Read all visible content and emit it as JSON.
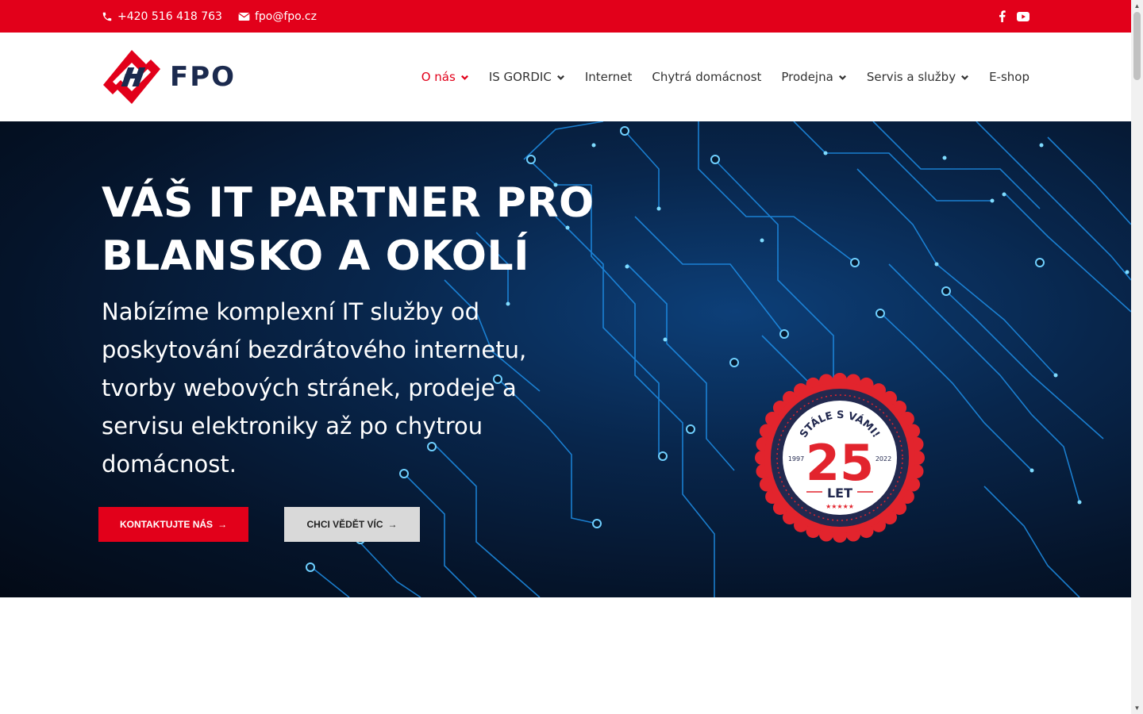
{
  "topbar": {
    "phone": "+420 516 418 763",
    "email": "fpo@fpo.cz",
    "phone_icon": "phone-icon",
    "email_icon": "envelope-icon",
    "social": [
      "facebook-icon",
      "youtube-icon"
    ]
  },
  "header": {
    "logo_text": "FPO",
    "nav": [
      {
        "label": "O nás",
        "dropdown": true,
        "active": true
      },
      {
        "label": "IS GORDIC",
        "dropdown": true
      },
      {
        "label": "Internet",
        "dropdown": false
      },
      {
        "label": "Chytrá domácnost",
        "dropdown": false
      },
      {
        "label": "Prodejna",
        "dropdown": true
      },
      {
        "label": "Servis a služby",
        "dropdown": true
      },
      {
        "label": "E-shop",
        "dropdown": false
      }
    ]
  },
  "hero": {
    "title": "VÁŠ IT PARTNER PRO BLANSKO A OKOLÍ",
    "subtitle": "Nabízíme komplexní IT služby od poskytování bezdrátového internetu, tvorby webových stránek, prodeje a servisu elektroniky až po chytrou domácnost.",
    "primary_button": "KONTAKTUJTE NÁS",
    "secondary_button": "CHCI VĚDĚT VÍC",
    "badge": {
      "top_text": "STÁLE S VÁMI!",
      "number": "25",
      "unit": "LET",
      "year_start": "1997",
      "year_end": "2022",
      "stars": "★★★★★"
    }
  },
  "colors": {
    "brand_red": "#e2001a",
    "brand_navy": "#1b2a4e",
    "hero_bg": "#05142a"
  }
}
